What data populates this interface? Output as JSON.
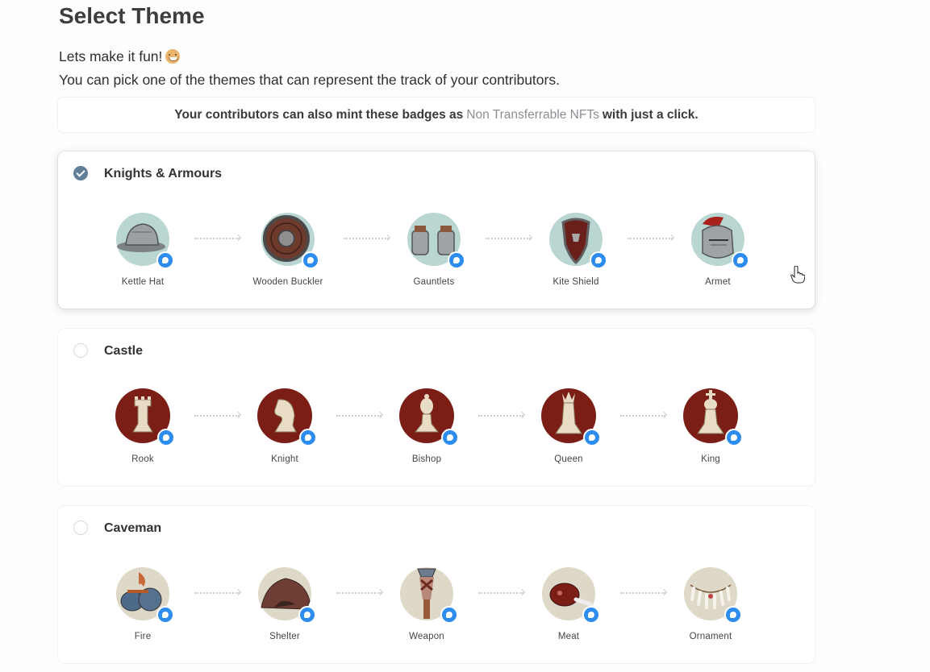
{
  "page": {
    "title": "Select Theme",
    "intro_line1": "Lets make it fun!",
    "intro_line2": "You can pick one of the themes that can represent the track of your contributors."
  },
  "notice": {
    "before": "Your contributors can also mint these badges as",
    "link": "Non Transferrable NFTs",
    "after": "with just a click."
  },
  "themes": [
    {
      "name": "Knights & Armours",
      "selected": true,
      "circle_color": "#b9d6d2",
      "badges": [
        {
          "label": "Kettle Hat",
          "icon": "kettle-hat-icon"
        },
        {
          "label": "Wooden Buckler",
          "icon": "wooden-buckler-icon"
        },
        {
          "label": "Gauntlets",
          "icon": "gauntlets-icon"
        },
        {
          "label": "Kite Shield",
          "icon": "kite-shield-icon"
        },
        {
          "label": "Armet",
          "icon": "armet-icon"
        }
      ]
    },
    {
      "name": "Castle",
      "selected": false,
      "circle_color": "#7b1e16",
      "badges": [
        {
          "label": "Rook",
          "icon": "rook-icon"
        },
        {
          "label": "Knight",
          "icon": "knight-icon"
        },
        {
          "label": "Bishop",
          "icon": "bishop-icon"
        },
        {
          "label": "Queen",
          "icon": "queen-icon"
        },
        {
          "label": "King",
          "icon": "king-icon"
        }
      ]
    },
    {
      "name": "Caveman",
      "selected": false,
      "circle_color": "#ddd8c8",
      "badges": [
        {
          "label": "Fire",
          "icon": "fire-icon"
        },
        {
          "label": "Shelter",
          "icon": "shelter-icon"
        },
        {
          "label": "Weapon",
          "icon": "weapon-icon"
        },
        {
          "label": "Meat",
          "icon": "meat-icon"
        },
        {
          "label": "Ornament",
          "icon": "ornament-icon"
        }
      ]
    }
  ],
  "colors": {
    "accent_check": "#627f98",
    "nft_dot": "#2d8cf0",
    "link_text": "#8a8f94"
  }
}
